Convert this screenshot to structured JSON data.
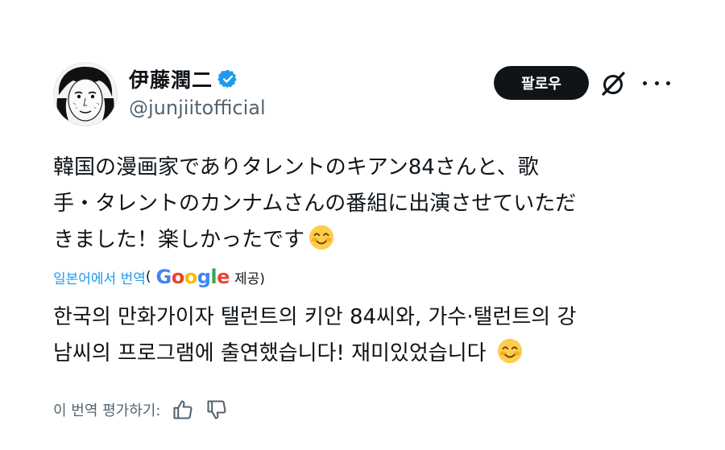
{
  "profile": {
    "display_name": "伊藤潤二",
    "handle": "@junjiitofficial"
  },
  "actions": {
    "follow_label": "팔로우"
  },
  "post": {
    "original_lines": [
      "韓国の漫画家でありタレントのキアン84さんと、歌",
      "手・タレントのカンナムさんの番組に出演させていただ",
      "きました！楽しかったです"
    ],
    "translate_label": "일본어에서 번역",
    "paren_open": "(",
    "google_word": "Google",
    "provided_label": "제공)",
    "translated_lines": [
      "한국의 만화가이자 탤런트의 키안 84씨와, 가수·탤런트의 강",
      "남씨의 프로그램에 출연했습니다! 재미있었습니다"
    ],
    "rate_label": "이 번역 평가하기:"
  },
  "icons": [
    "verified-badge-icon",
    "grok-icon",
    "more-icon",
    "smiling-face-emoji",
    "thumbs-up-icon",
    "thumbs-down-icon"
  ],
  "colors": {
    "text": "#0f1419",
    "secondary": "#536471",
    "link": "#1d9bf0",
    "follow_bg": "#0f1419",
    "google_blue": "#4285F4",
    "google_red": "#EA4335",
    "google_yellow": "#FBBC05",
    "google_green": "#34A853"
  }
}
